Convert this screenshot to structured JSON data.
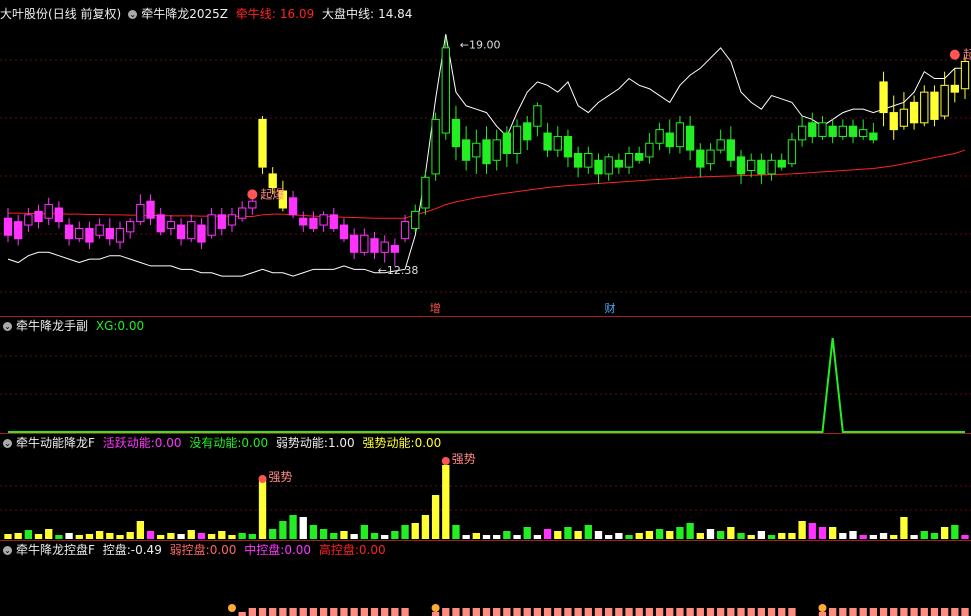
{
  "main": {
    "stock_name": "大叶股份",
    "period": "(日线 前复权)",
    "indicator": "牵牛降龙2025Z",
    "line1_label": "牵牛线:",
    "line1_value": "16.09",
    "line2_label": "大盘中线:",
    "line2_value": "14.84",
    "high_label": "19.00",
    "low_label": "12.38",
    "signal_left": "起爆",
    "signal_right": "起爆",
    "event_zeng": "增",
    "event_cai": "财"
  },
  "sub1": {
    "title": "牵牛降龙手副",
    "xg_label": "XG:",
    "xg_value": "0.00"
  },
  "sub2": {
    "title": "牵牛动能降龙F",
    "a_label": "活跃动能:",
    "a_value": "0.00",
    "b_label": "没有动能:",
    "b_value": "0.00",
    "c_label": "弱势动能:",
    "c_value": "1.00",
    "d_label": "强势动能:",
    "d_value": "0.00",
    "strong1": "强势",
    "strong2": "强势"
  },
  "sub3": {
    "title": "牵牛降龙控盘F",
    "k_label": "控盘:",
    "k_value": "-0.49",
    "w_label": "弱控盘:",
    "w_value": "0.00",
    "m_label": "中控盘:",
    "m_value": "0.00",
    "h_label": "高控盘:",
    "h_value": "0.00"
  },
  "colors": {
    "magenta": "#ff33ff",
    "green": "#22ee22",
    "yellow": "#ffff33",
    "red": "#ff2222",
    "white": "#ffffff",
    "salmon": "#ff8c80"
  },
  "chart_data": {
    "type": "candlestick",
    "ylim": [
      11.5,
      19.6
    ],
    "candles": [
      [
        13.9,
        13.4,
        14.2,
        13.2,
        "m"
      ],
      [
        13.8,
        13.3,
        14.0,
        13.1,
        "m"
      ],
      [
        13.7,
        14.0,
        14.2,
        13.5,
        "m"
      ],
      [
        14.1,
        13.8,
        14.3,
        13.6,
        "m"
      ],
      [
        13.9,
        14.3,
        14.5,
        13.7,
        "m"
      ],
      [
        14.2,
        13.8,
        14.4,
        13.6,
        "m"
      ],
      [
        13.7,
        13.3,
        13.9,
        13.1,
        "m"
      ],
      [
        13.3,
        13.6,
        13.8,
        13.2,
        "m"
      ],
      [
        13.6,
        13.2,
        13.8,
        13.0,
        "m"
      ],
      [
        13.4,
        13.7,
        13.9,
        13.3,
        "m"
      ],
      [
        13.6,
        13.3,
        13.9,
        13.1,
        "m"
      ],
      [
        13.2,
        13.6,
        13.8,
        13.0,
        "m"
      ],
      [
        13.5,
        13.8,
        13.9,
        13.3,
        "m"
      ],
      [
        13.8,
        14.3,
        14.6,
        13.7,
        "m"
      ],
      [
        14.4,
        13.9,
        14.6,
        13.7,
        "m"
      ],
      [
        14.0,
        13.5,
        14.2,
        13.4,
        "m"
      ],
      [
        13.6,
        13.8,
        14.0,
        13.4,
        "m"
      ],
      [
        13.7,
        13.3,
        13.9,
        13.1,
        "m"
      ],
      [
        13.3,
        13.8,
        14.0,
        13.2,
        "m"
      ],
      [
        13.7,
        13.2,
        13.9,
        13.0,
        "m"
      ],
      [
        13.4,
        14.0,
        14.2,
        13.3,
        "m"
      ],
      [
        14.0,
        13.6,
        14.2,
        13.4,
        "m"
      ],
      [
        13.7,
        14.0,
        14.2,
        13.5,
        "m"
      ],
      [
        13.9,
        14.2,
        14.4,
        13.8,
        "m"
      ],
      [
        14.2,
        14.4,
        14.5,
        14.0,
        "m"
      ],
      [
        16.8,
        15.4,
        16.9,
        15.2,
        "y"
      ],
      [
        15.2,
        14.8,
        15.4,
        14.6,
        "y"
      ],
      [
        14.7,
        14.2,
        15.0,
        14.1,
        "y"
      ],
      [
        14.5,
        14.0,
        14.7,
        13.9,
        "m"
      ],
      [
        13.9,
        13.7,
        14.1,
        13.5,
        "m"
      ],
      [
        13.9,
        13.6,
        14.1,
        13.5,
        "m"
      ],
      [
        13.7,
        14.0,
        14.1,
        13.5,
        "m"
      ],
      [
        14.0,
        13.6,
        14.2,
        13.5,
        "m"
      ],
      [
        13.7,
        13.3,
        13.9,
        13.2,
        "m"
      ],
      [
        13.4,
        12.9,
        13.6,
        12.7,
        "m"
      ],
      [
        12.9,
        13.4,
        13.6,
        12.8,
        "m"
      ],
      [
        13.3,
        12.9,
        13.5,
        12.7,
        "m"
      ],
      [
        12.9,
        13.2,
        13.4,
        12.6,
        "m"
      ],
      [
        13.1,
        12.9,
        13.3,
        12.5,
        "m"
      ],
      [
        13.3,
        13.8,
        14.0,
        13.2,
        "m"
      ],
      [
        13.6,
        14.1,
        14.3,
        13.5,
        "g"
      ],
      [
        14.2,
        15.1,
        15.3,
        14.0,
        "g"
      ],
      [
        15.2,
        16.8,
        17.0,
        15.0,
        "g"
      ],
      [
        16.4,
        18.9,
        19.2,
        16.2,
        "g"
      ],
      [
        16.8,
        16.0,
        17.2,
        15.6,
        "g"
      ],
      [
        16.2,
        15.6,
        16.6,
        15.3,
        "g"
      ],
      [
        15.7,
        16.1,
        16.5,
        15.2,
        "g"
      ],
      [
        16.2,
        15.5,
        16.6,
        15.2,
        "g"
      ],
      [
        15.6,
        16.2,
        16.5,
        15.3,
        "g"
      ],
      [
        16.4,
        15.8,
        16.6,
        15.4,
        "g"
      ],
      [
        15.8,
        16.6,
        16.8,
        15.5,
        "g"
      ],
      [
        16.7,
        16.2,
        16.9,
        15.9,
        "g"
      ],
      [
        16.6,
        17.2,
        17.3,
        16.3,
        "g"
      ],
      [
        16.4,
        15.9,
        16.7,
        15.7,
        "g"
      ],
      [
        15.9,
        16.3,
        16.6,
        15.7,
        "g"
      ],
      [
        16.3,
        15.7,
        16.5,
        15.4,
        "g"
      ],
      [
        15.8,
        15.4,
        16.0,
        15.1,
        "g"
      ],
      [
        15.4,
        15.8,
        16.0,
        15.2,
        "g"
      ],
      [
        15.6,
        15.2,
        15.8,
        14.9,
        "g"
      ],
      [
        15.2,
        15.7,
        15.8,
        15.0,
        "g"
      ],
      [
        15.6,
        15.4,
        15.8,
        15.2,
        "g"
      ],
      [
        15.4,
        15.8,
        16.0,
        15.2,
        "g"
      ],
      [
        15.8,
        15.6,
        16.0,
        15.5,
        "g"
      ],
      [
        15.7,
        16.1,
        16.4,
        15.5,
        "g"
      ],
      [
        16.1,
        16.5,
        16.7,
        15.9,
        "g"
      ],
      [
        16.4,
        16.0,
        16.8,
        15.8,
        "g"
      ],
      [
        16.0,
        16.7,
        16.9,
        15.8,
        "g"
      ],
      [
        16.6,
        15.9,
        16.9,
        15.6,
        "g"
      ],
      [
        15.9,
        15.4,
        16.1,
        15.1,
        "g"
      ],
      [
        15.5,
        15.9,
        16.1,
        15.3,
        "g"
      ],
      [
        15.9,
        16.2,
        16.5,
        15.8,
        "g"
      ],
      [
        16.2,
        15.6,
        16.6,
        15.4,
        "g"
      ],
      [
        15.7,
        15.2,
        15.9,
        14.9,
        "g"
      ],
      [
        15.3,
        15.6,
        15.8,
        15.1,
        "g"
      ],
      [
        15.6,
        15.2,
        15.8,
        14.9,
        "g"
      ],
      [
        15.2,
        15.6,
        15.8,
        15.0,
        "g"
      ],
      [
        15.6,
        15.4,
        15.8,
        15.3,
        "g"
      ],
      [
        15.5,
        16.2,
        16.4,
        15.4,
        "g"
      ],
      [
        16.2,
        16.6,
        16.9,
        16.0,
        "g"
      ],
      [
        16.7,
        16.3,
        17.0,
        16.1,
        "g"
      ],
      [
        16.3,
        16.7,
        16.9,
        16.2,
        "g"
      ],
      [
        16.6,
        16.3,
        16.8,
        16.1,
        "g"
      ],
      [
        16.3,
        16.6,
        16.8,
        16.2,
        "g"
      ],
      [
        16.6,
        16.3,
        16.8,
        16.1,
        "g"
      ],
      [
        16.3,
        16.5,
        16.8,
        16.2,
        "g"
      ],
      [
        16.4,
        16.2,
        16.7,
        16.1,
        "g"
      ],
      [
        17.9,
        17.0,
        18.2,
        16.6,
        "y"
      ],
      [
        17.0,
        16.5,
        17.5,
        16.2,
        "y"
      ],
      [
        16.6,
        17.1,
        17.6,
        16.5,
        "y"
      ],
      [
        17.3,
        16.7,
        17.5,
        16.5,
        "y"
      ],
      [
        16.7,
        17.6,
        17.8,
        16.6,
        "y"
      ],
      [
        17.6,
        16.8,
        17.8,
        16.6,
        "y"
      ],
      [
        16.9,
        17.8,
        18.2,
        16.8,
        "y"
      ],
      [
        17.8,
        17.6,
        18.3,
        17.3,
        "y"
      ],
      [
        17.7,
        18.5,
        18.6,
        17.4,
        "y"
      ]
    ],
    "ma_red": [
      14.05,
      14.05,
      14.04,
      14.04,
      14.03,
      14.03,
      14.02,
      14.02,
      14.01,
      14.01,
      14.0,
      14.0,
      13.99,
      13.99,
      13.98,
      13.98,
      13.97,
      13.97,
      13.97,
      13.96,
      13.96,
      13.96,
      13.96,
      13.95,
      13.95,
      14.0,
      14.02,
      14.02,
      14.0,
      13.98,
      13.96,
      13.95,
      13.94,
      13.93,
      13.92,
      13.91,
      13.9,
      13.9,
      13.9,
      13.9,
      14.0,
      14.08,
      14.18,
      14.3,
      14.38,
      14.44,
      14.5,
      14.55,
      14.6,
      14.64,
      14.68,
      14.72,
      14.76,
      14.8,
      14.83,
      14.86,
      14.88,
      14.9,
      14.92,
      14.94,
      14.96,
      14.98,
      15.0,
      15.02,
      15.04,
      15.06,
      15.08,
      15.1,
      15.11,
      15.12,
      15.13,
      15.14,
      15.15,
      15.16,
      15.17,
      15.18,
      15.19,
      15.2,
      15.22,
      15.24,
      15.26,
      15.28,
      15.3,
      15.32,
      15.34,
      15.36,
      15.4,
      15.44,
      15.5,
      15.56,
      15.62,
      15.68,
      15.74,
      15.8,
      15.9
    ],
    "white_line": [
      12.7,
      12.6,
      12.8,
      12.9,
      12.9,
      12.8,
      12.7,
      12.6,
      12.7,
      12.7,
      12.8,
      12.8,
      12.7,
      12.6,
      12.5,
      12.5,
      12.5,
      12.4,
      12.4,
      12.3,
      12.3,
      12.2,
      12.2,
      12.2,
      12.3,
      12.4,
      12.3,
      12.3,
      12.2,
      12.3,
      12.4,
      12.4,
      12.4,
      12.5,
      12.4,
      12.4,
      12.3,
      12.3,
      12.35,
      12.4,
      13.4,
      15.2,
      17.4,
      19.3,
      17.6,
      17.2,
      17.1,
      17.0,
      16.6,
      16.3,
      17.0,
      17.6,
      17.9,
      17.8,
      17.6,
      17.9,
      17.2,
      17.0,
      17.3,
      17.5,
      17.7,
      18.0,
      17.8,
      17.7,
      17.5,
      17.3,
      17.8,
      18.1,
      18.3,
      18.6,
      18.9,
      18.5,
      17.6,
      17.3,
      17.1,
      17.5,
      17.4,
      17.3,
      16.9,
      16.8,
      16.6,
      16.8,
      17.0,
      17.1,
      17.1,
      17.0,
      17.1,
      17.2,
      17.3,
      17.6,
      18.2,
      18.0,
      18.0,
      18.3,
      18.3
    ],
    "xg": [
      0,
      0,
      0,
      0,
      0,
      0,
      0,
      0,
      0,
      0,
      0,
      0,
      0,
      0,
      0,
      0,
      0,
      0,
      0,
      0,
      0,
      0,
      0,
      0,
      0,
      0,
      0,
      0,
      0,
      0,
      0,
      0,
      0,
      0,
      0,
      0,
      0,
      0,
      0,
      0,
      0,
      0,
      0,
      0,
      0,
      0,
      0,
      0,
      0,
      0,
      0,
      0,
      0,
      0,
      0,
      0,
      0,
      0,
      0,
      0,
      0,
      0,
      0,
      0,
      0,
      0,
      0,
      0,
      0,
      0,
      0,
      0,
      0,
      0,
      0,
      0,
      0,
      0,
      0,
      0,
      0,
      0,
      0,
      0,
      0,
      0,
      0,
      0,
      0,
      0,
      0,
      0,
      0,
      0,
      0
    ],
    "xg_spike_index": 81,
    "energy": [
      [
        5,
        "y"
      ],
      [
        6,
        "y"
      ],
      [
        9,
        "g"
      ],
      [
        5,
        "y"
      ],
      [
        10,
        "y"
      ],
      [
        4,
        "g"
      ],
      [
        6,
        "w"
      ],
      [
        4,
        "y"
      ],
      [
        5,
        "y"
      ],
      [
        8,
        "y"
      ],
      [
        6,
        "y"
      ],
      [
        4,
        "y"
      ],
      [
        7,
        "y"
      ],
      [
        18,
        "y"
      ],
      [
        8,
        "m"
      ],
      [
        4,
        "y"
      ],
      [
        6,
        "y"
      ],
      [
        5,
        "w"
      ],
      [
        9,
        "y"
      ],
      [
        6,
        "m"
      ],
      [
        5,
        "y"
      ],
      [
        8,
        "y"
      ],
      [
        4,
        "y"
      ],
      [
        6,
        "g"
      ],
      [
        5,
        "g"
      ],
      [
        60,
        "y"
      ],
      [
        10,
        "g"
      ],
      [
        18,
        "g"
      ],
      [
        24,
        "g"
      ],
      [
        22,
        "w"
      ],
      [
        14,
        "g"
      ],
      [
        10,
        "g"
      ],
      [
        6,
        "g"
      ],
      [
        8,
        "y"
      ],
      [
        5,
        "w"
      ],
      [
        14,
        "g"
      ],
      [
        6,
        "g"
      ],
      [
        4,
        "w"
      ],
      [
        8,
        "g"
      ],
      [
        14,
        "g"
      ],
      [
        16,
        "y"
      ],
      [
        24,
        "y"
      ],
      [
        44,
        "y"
      ],
      [
        74,
        "y"
      ],
      [
        14,
        "g"
      ],
      [
        4,
        "w"
      ],
      [
        6,
        "y"
      ],
      [
        4,
        "w"
      ],
      [
        4,
        "w"
      ],
      [
        8,
        "g"
      ],
      [
        4,
        "w"
      ],
      [
        12,
        "g"
      ],
      [
        4,
        "w"
      ],
      [
        10,
        "m"
      ],
      [
        8,
        "y"
      ],
      [
        12,
        "g"
      ],
      [
        8,
        "y"
      ],
      [
        14,
        "g"
      ],
      [
        8,
        "w"
      ],
      [
        4,
        "w"
      ],
      [
        6,
        "w"
      ],
      [
        4,
        "g"
      ],
      [
        6,
        "y"
      ],
      [
        8,
        "y"
      ],
      [
        10,
        "g"
      ],
      [
        8,
        "y"
      ],
      [
        12,
        "g"
      ],
      [
        16,
        "g"
      ],
      [
        6,
        "y"
      ],
      [
        10,
        "w"
      ],
      [
        8,
        "g"
      ],
      [
        12,
        "y"
      ],
      [
        6,
        "g"
      ],
      [
        4,
        "y"
      ],
      [
        8,
        "w"
      ],
      [
        4,
        "g"
      ],
      [
        6,
        "y"
      ],
      [
        6,
        "y"
      ],
      [
        18,
        "y"
      ],
      [
        16,
        "m"
      ],
      [
        12,
        "m"
      ],
      [
        12,
        "y"
      ],
      [
        6,
        "w"
      ],
      [
        8,
        "w"
      ],
      [
        4,
        "m"
      ],
      [
        4,
        "w"
      ],
      [
        6,
        "w"
      ],
      [
        4,
        "y"
      ],
      [
        22,
        "y"
      ],
      [
        4,
        "w"
      ],
      [
        8,
        "g"
      ],
      [
        6,
        "g"
      ],
      [
        12,
        "y"
      ],
      [
        14,
        "g"
      ],
      [
        4,
        "m"
      ]
    ],
    "control": [
      0,
      0,
      0,
      0,
      0,
      0,
      0,
      0,
      0,
      0,
      0,
      0,
      0,
      0,
      0,
      0,
      0,
      0,
      0,
      0,
      0,
      0,
      0,
      4,
      8,
      8,
      8,
      8,
      8,
      8,
      8,
      8,
      8,
      8,
      8,
      8,
      8,
      8,
      8,
      8,
      0,
      0,
      4,
      8,
      8,
      8,
      8,
      8,
      8,
      8,
      8,
      8,
      8,
      8,
      8,
      8,
      8,
      8,
      8,
      8,
      8,
      8,
      8,
      8,
      8,
      8,
      8,
      8,
      8,
      8,
      8,
      8,
      8,
      8,
      8,
      8,
      8,
      8,
      0,
      0,
      4,
      8,
      8,
      8,
      8,
      8,
      8,
      8,
      8,
      8,
      8,
      8,
      8,
      8,
      8
    ]
  }
}
